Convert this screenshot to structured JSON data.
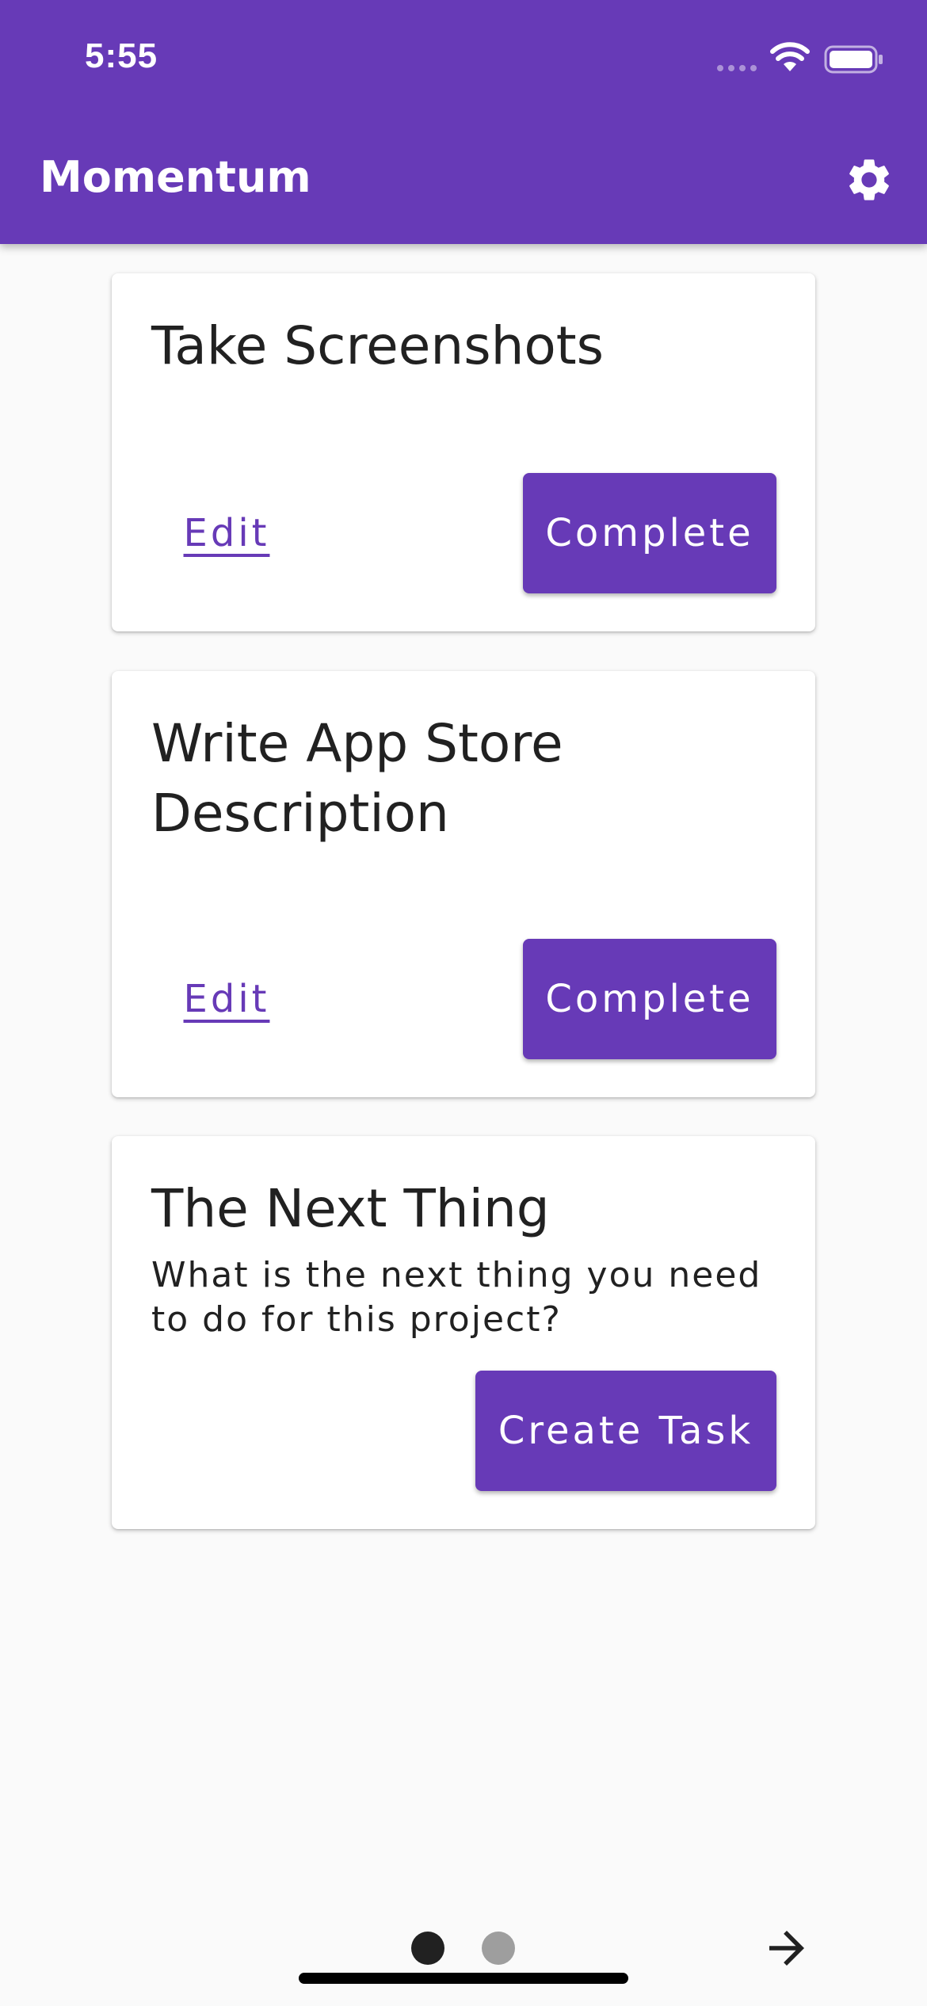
{
  "status_bar": {
    "time": "5:55"
  },
  "app_bar": {
    "title": "Momentum"
  },
  "tasks": [
    {
      "title": "Take Screenshots",
      "edit_label": "Edit",
      "complete_label": "Complete"
    },
    {
      "title": "Write App Store Description",
      "edit_label": "Edit",
      "complete_label": "Complete"
    }
  ],
  "next_thing": {
    "title": "The Next Thing",
    "prompt": "What is the next thing you need to do for this project?",
    "button_label": "Create Task"
  },
  "pager": {
    "page_count": 2,
    "current_page": 1
  },
  "colors": {
    "primary": "#673ab7",
    "background": "#fafafa",
    "card": "#ffffff",
    "dot_active": "#212121",
    "dot_inactive": "#9e9e9e"
  },
  "icons": [
    "cellular-signal-icon",
    "wifi-icon",
    "battery-icon",
    "gear-icon",
    "arrow-right-icon"
  ]
}
